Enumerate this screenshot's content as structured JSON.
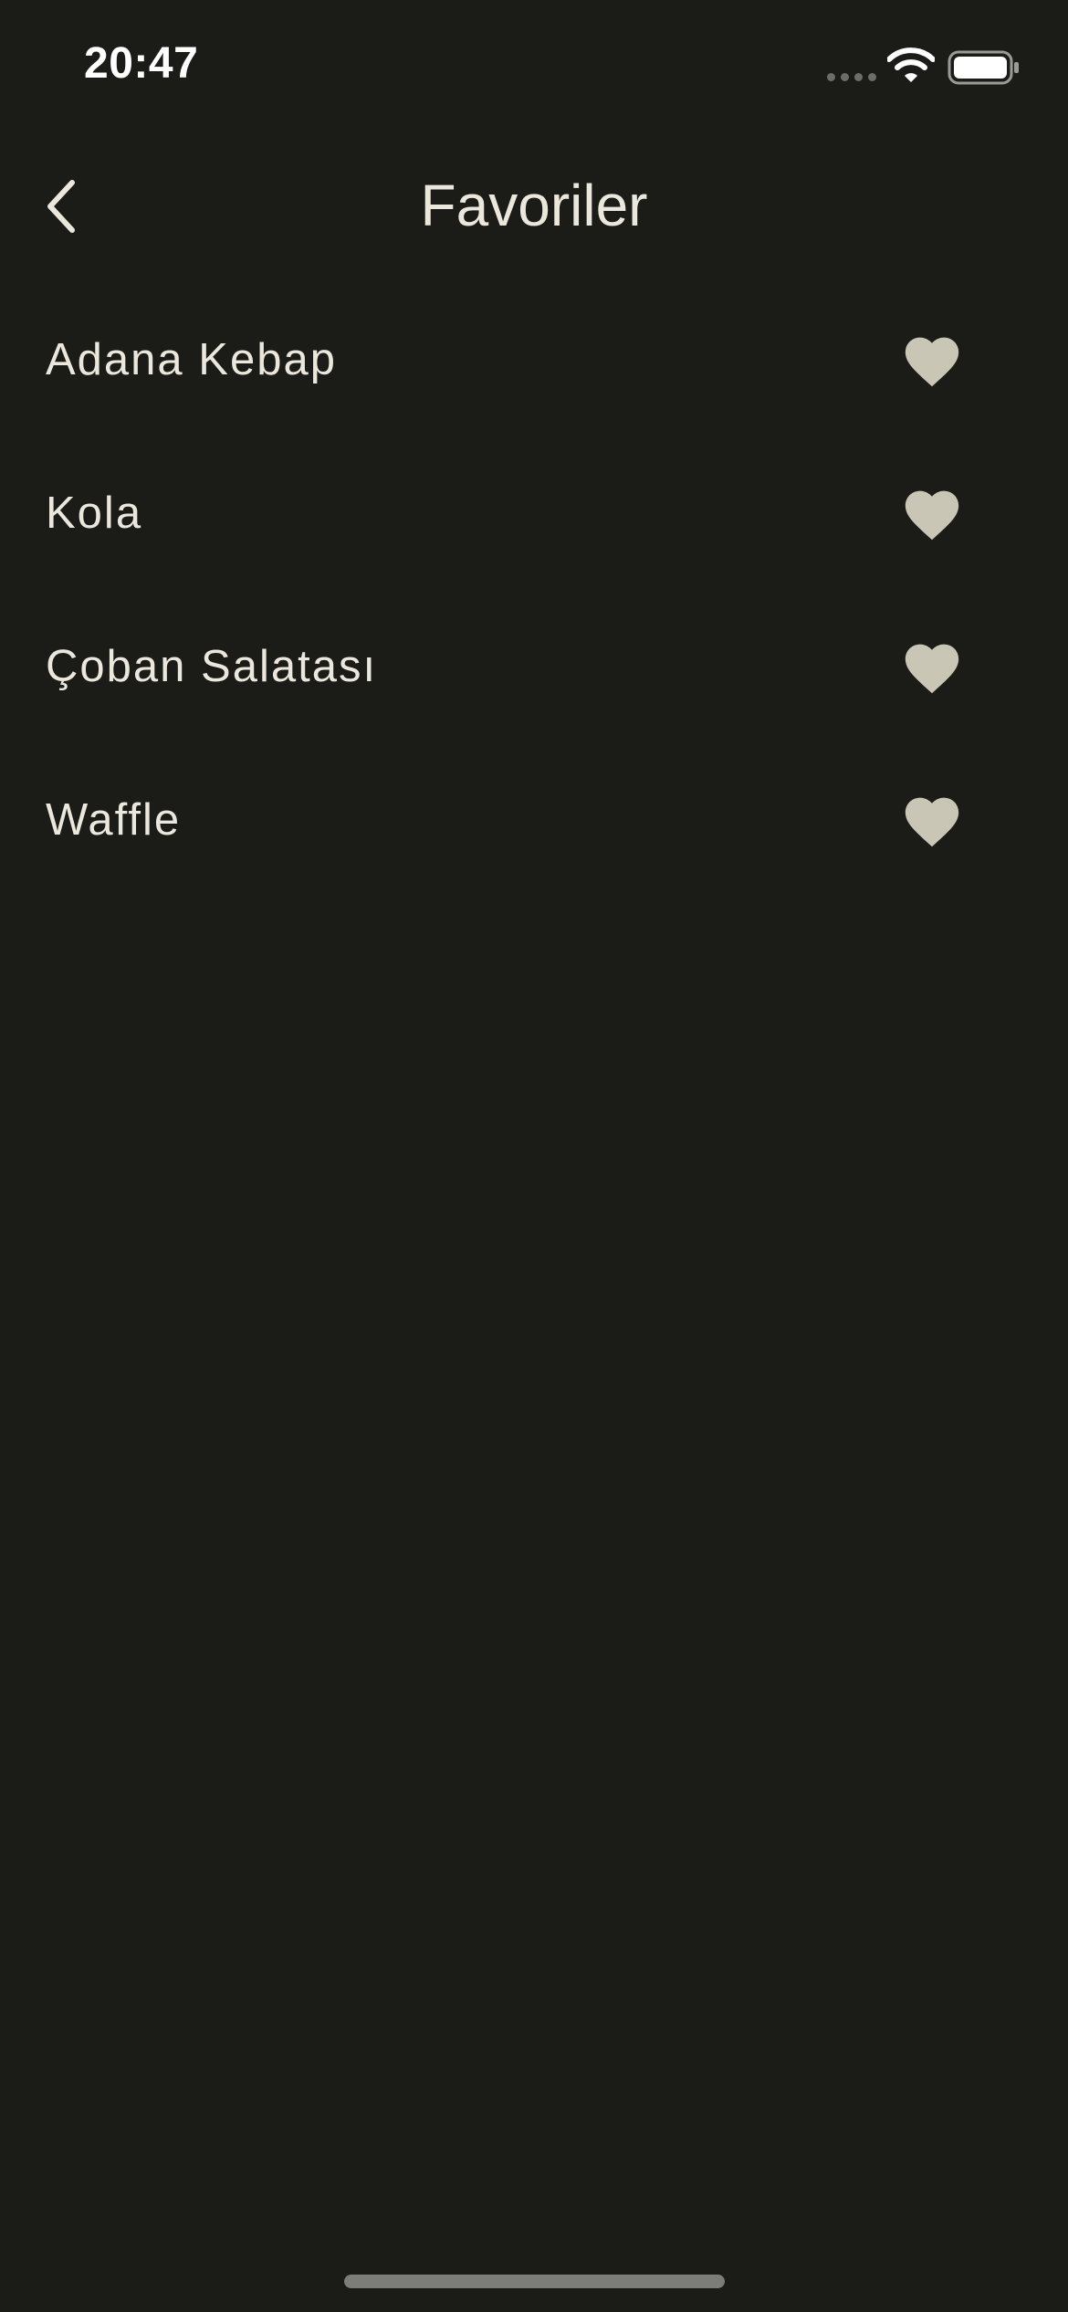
{
  "status_bar": {
    "time": "20:47",
    "icons": [
      "signal-dots-icon",
      "wifi-icon",
      "battery-icon"
    ]
  },
  "nav": {
    "back_icon": "chevron-left-icon",
    "title": "Favoriler"
  },
  "favorites": [
    {
      "label": "Adana Kebap",
      "icon": "heart-icon",
      "favorited": true
    },
    {
      "label": "Kola",
      "icon": "heart-icon",
      "favorited": true
    },
    {
      "label": "Çoban Salatası",
      "icon": "heart-icon",
      "favorited": true
    },
    {
      "label": "Waffle",
      "icon": "heart-icon",
      "favorited": true
    }
  ],
  "colors": {
    "background": "#1b1c18",
    "text": "#ebe7dc",
    "heart": "#c9c6b5"
  }
}
